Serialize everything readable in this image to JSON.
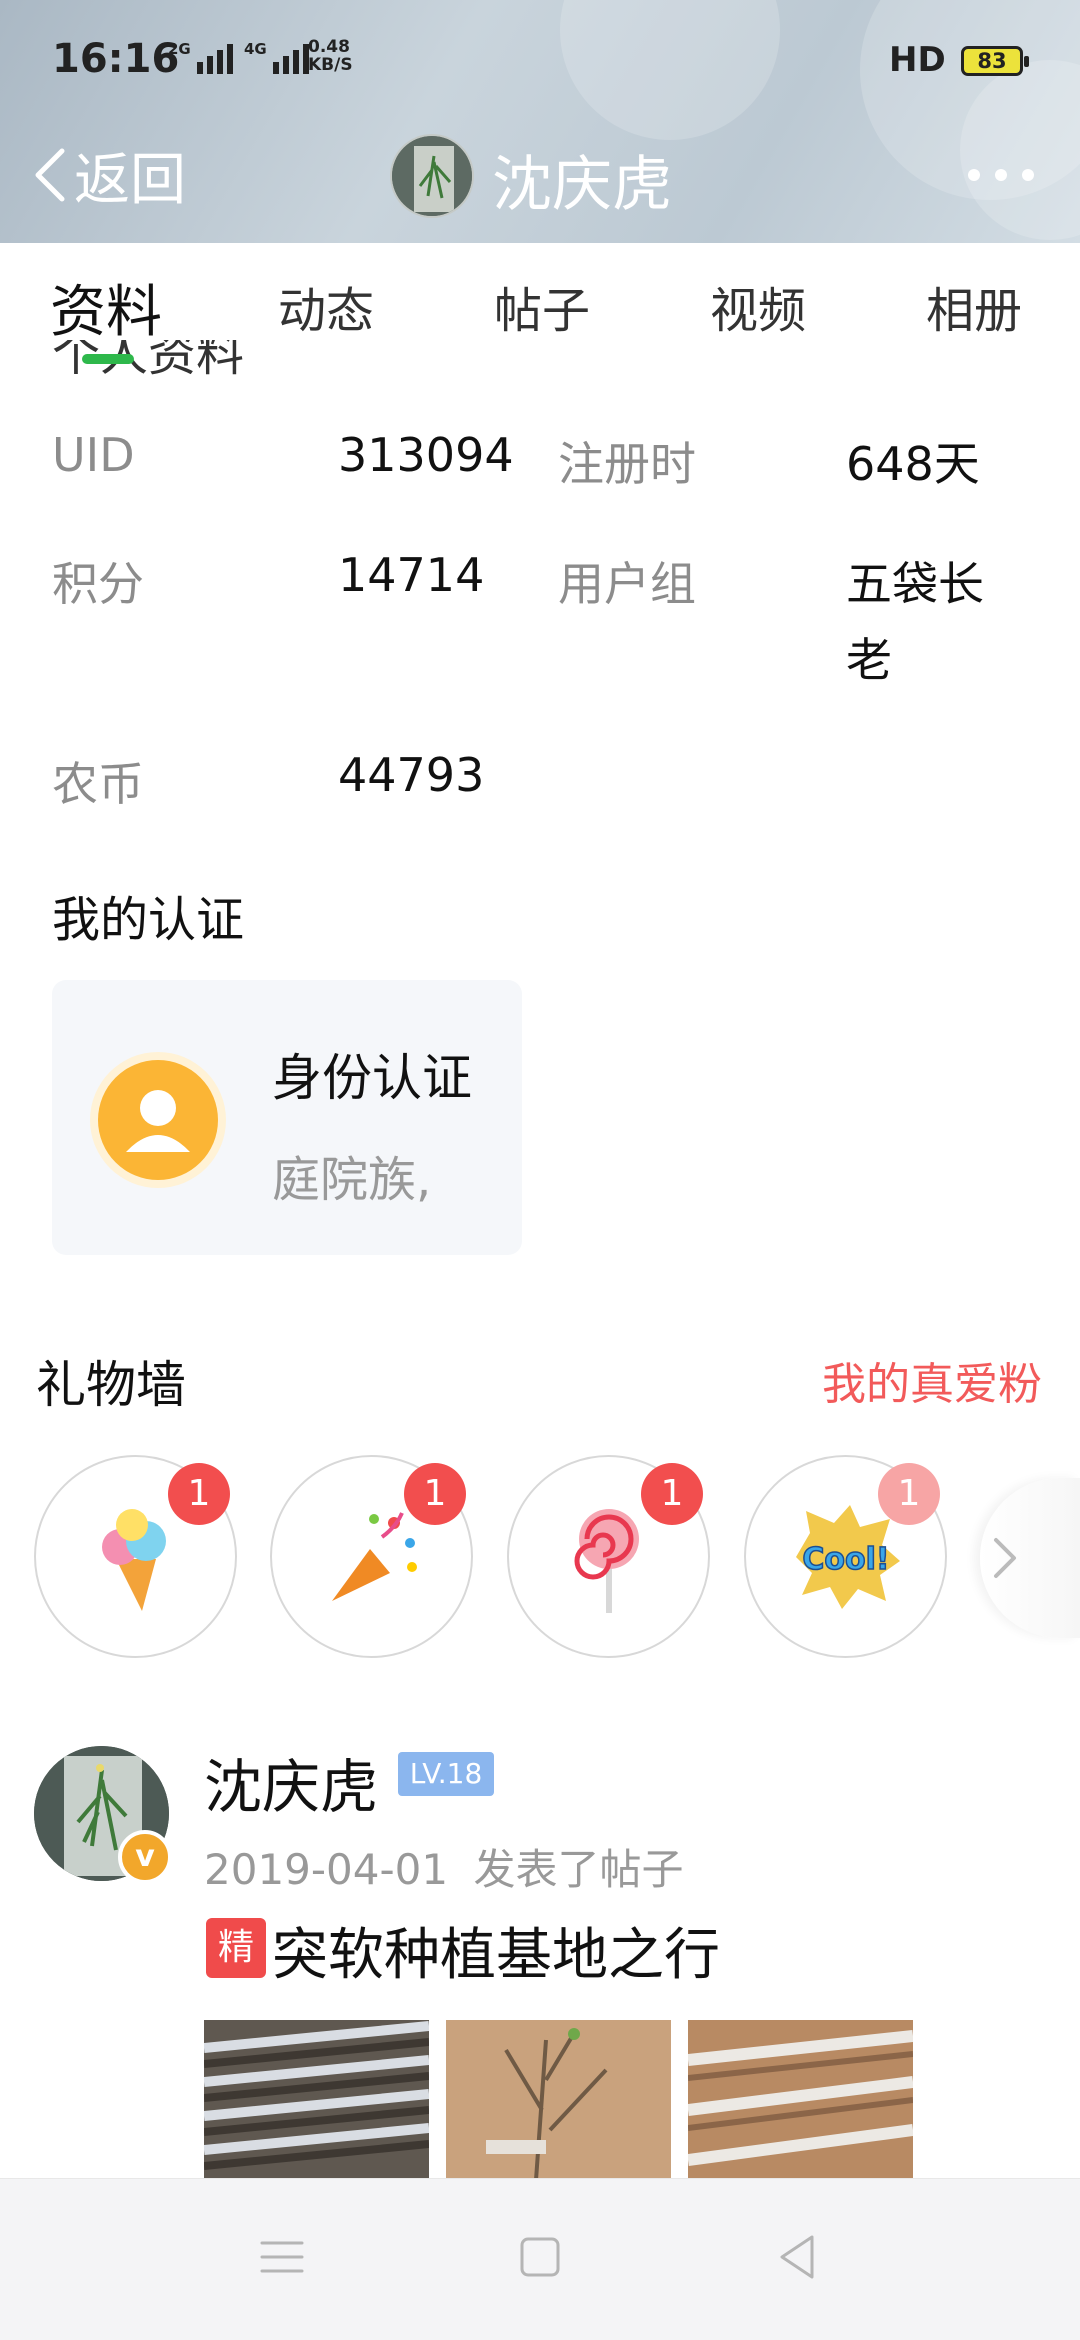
{
  "status_bar": {
    "time": "16:16",
    "signal_1": "2G",
    "signal_2": "4G",
    "net_speed_value": "0.48",
    "net_speed_unit": "KB/S",
    "hd": "HD",
    "battery": "83"
  },
  "header": {
    "back_label": "返回",
    "title": "沈庆虎",
    "more_icon": "more-icon"
  },
  "tabs": [
    "资料",
    "动态",
    "帖子",
    "视频",
    "相册"
  ],
  "active_tab": "资料",
  "basic_info": {
    "section_title": "个人资料",
    "rows": [
      {
        "key": "UID",
        "value": "313094",
        "key2": "注册时",
        "value2": "648天"
      },
      {
        "key": "积分",
        "value": "14714",
        "key2": "用户组",
        "value2_line1": "五袋长",
        "value2_line2": "老"
      },
      {
        "key": "农币",
        "value": "44793"
      }
    ]
  },
  "certification": {
    "title": "我的认证",
    "card_name": "身份认证",
    "card_desc": "庭院族,"
  },
  "gift_wall": {
    "title": "礼物墙",
    "link": "我的真爱粉",
    "gifts": [
      {
        "icon": "ice-cream-icon",
        "count": "1"
      },
      {
        "icon": "party-popper-icon",
        "count": "1"
      },
      {
        "icon": "lollipop-icon",
        "count": "1"
      },
      {
        "icon": "cool-sticker-icon",
        "count": "1"
      }
    ]
  },
  "feed": {
    "author": "沈庆虎",
    "level": "LV.18",
    "date": "2019-04-01",
    "action": "发表了帖子",
    "featured_badge": "精",
    "post_title": "突软种植基地之行",
    "cool_text": "Cool!"
  },
  "colors": {
    "accent_green": "#2eb84b",
    "link_red": "#f25a5a",
    "badge_red": "#f24e4e",
    "cert_orange": "#fbb535",
    "level_blue": "#8bb6ee"
  }
}
